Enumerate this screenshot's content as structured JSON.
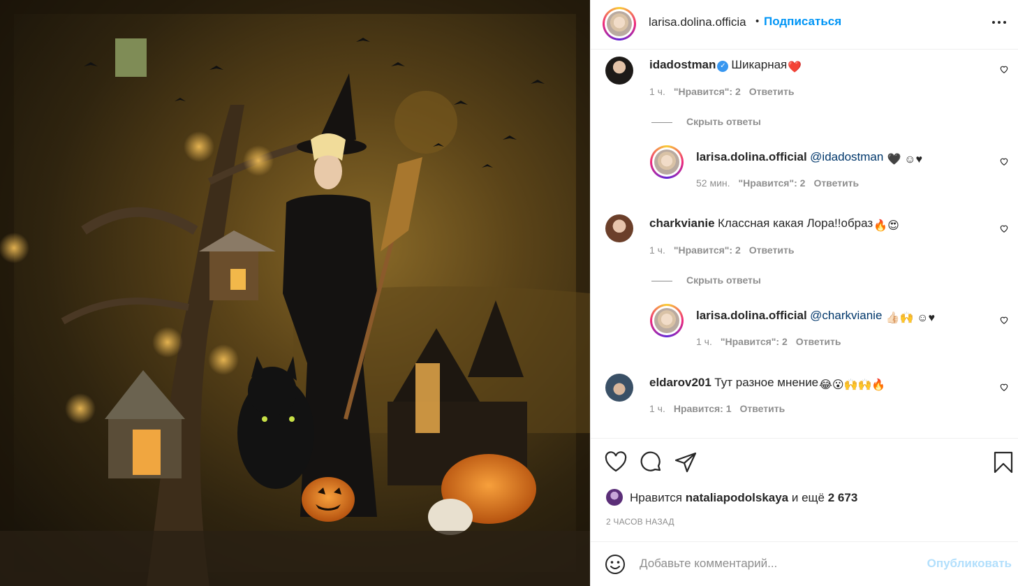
{
  "post": {
    "image_alt": "Halloween witch illustration"
  },
  "header": {
    "username": "larisa.dolina.officia",
    "dot": "•",
    "follow_label": "Подписаться"
  },
  "comments": [
    {
      "username": "idadostman",
      "verified": true,
      "text": "Шикарная",
      "emoji": "❤️",
      "age": "1 ч.",
      "likes": "\"Нравится\": 2",
      "reply_label": "Ответить",
      "hide_replies_label": "Скрыть ответы",
      "replies": [
        {
          "username": "larisa.dolina.official",
          "mention": "@idadostman",
          "emoji": "🖤 ☺♥",
          "age": "52 мин.",
          "likes": "\"Нравится\": 2",
          "reply_label": "Ответить"
        }
      ]
    },
    {
      "username": "charkvianie",
      "text": "Классная какая Лора!!образ",
      "emoji": "🔥😍",
      "age": "1 ч.",
      "likes": "\"Нравится\": 2",
      "reply_label": "Ответить",
      "hide_replies_label": "Скрыть ответы",
      "replies": [
        {
          "username": "larisa.dolina.official",
          "mention": "@charkvianie",
          "emoji": "👍🏻🙌 ☺♥",
          "age": "1 ч.",
          "likes": "\"Нравится\": 2",
          "reply_label": "Ответить"
        }
      ]
    },
    {
      "username": "eldarov201",
      "text": "Тут разное мнение",
      "emoji": "😂😮🙌🙌🔥",
      "age": "1 ч.",
      "likes": "Нравится: 1",
      "reply_label": "Ответить"
    }
  ],
  "likes_bar": {
    "prefix": "Нравится",
    "liker": "nataliapodolskaya",
    "and_more": "и ещё",
    "count": "2 673"
  },
  "timestamp": "2 ЧАСОВ НАЗАД",
  "add_comment": {
    "placeholder": "Добавьте комментарий...",
    "publish_label": "Опубликовать"
  },
  "icons": {
    "like": "heart-icon",
    "comment": "comment-icon",
    "share": "paper-plane-icon",
    "save": "bookmark-icon",
    "emoji": "smiley-icon",
    "more": "more-dots-icon"
  }
}
